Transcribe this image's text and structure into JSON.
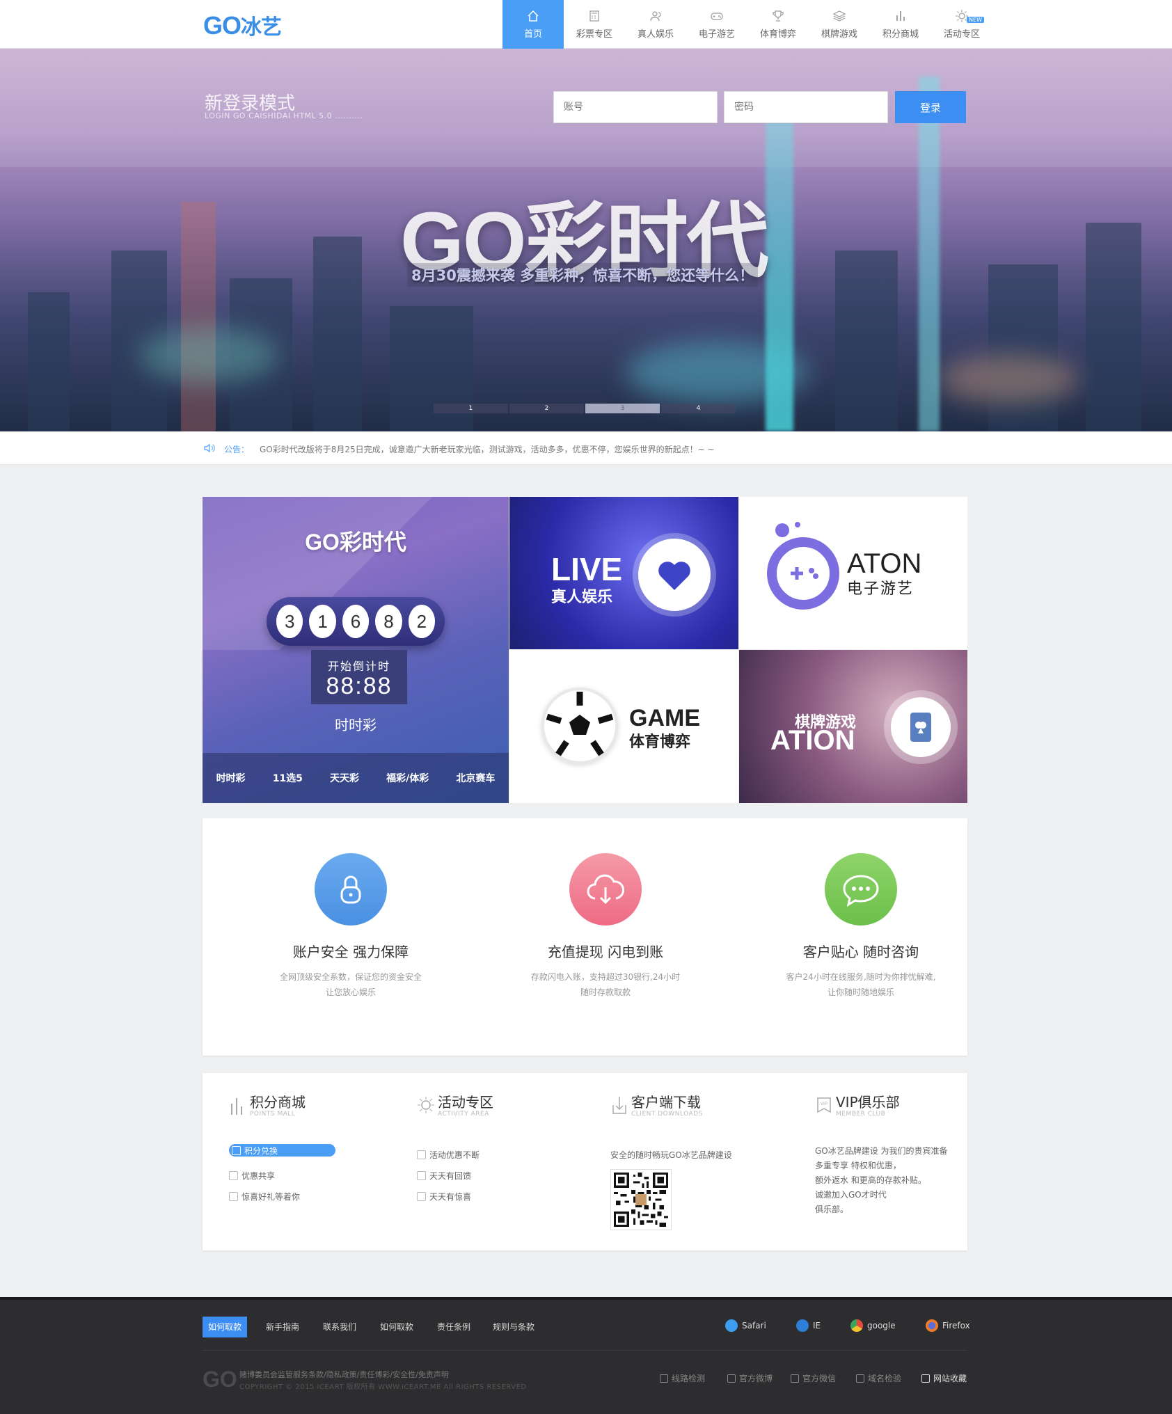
{
  "header": {
    "logo_latin": "GO",
    "logo_cn": "冰艺",
    "nav": [
      {
        "label": "首页",
        "icon": "home-icon",
        "active": true
      },
      {
        "label": "彩票专区",
        "icon": "calculator-icon"
      },
      {
        "label": "真人娱乐",
        "icon": "users-icon"
      },
      {
        "label": "电子游艺",
        "icon": "gamepad-icon"
      },
      {
        "label": "体育博弈",
        "icon": "trophy-icon"
      },
      {
        "label": "棋牌游戏",
        "icon": "layers-icon"
      },
      {
        "label": "积分商城",
        "icon": "bar-chart-icon"
      },
      {
        "label": "活动专区",
        "icon": "sun-icon",
        "badge": "NEW"
      }
    ]
  },
  "hero": {
    "login_title": "新登录模式",
    "login_subtitle": "LOGIN GO CAISHIDAI HTML 5.0 ..........",
    "account_placeholder": "账号",
    "password_placeholder": "密码",
    "login_button": "登录",
    "title": "GO彩时代",
    "subtitle": "8月30震撼来袭 多重彩种，惊喜不断，您还等什么！",
    "slides": [
      "1",
      "2",
      "3",
      "4"
    ],
    "active_slide": 3
  },
  "notice": {
    "label": "公告：",
    "text": "GO彩时代改版将于8月25日完成，诚意邀广大新老玩家光临，测试游戏，活动多多，优惠不停，您娱乐世界的新起点！~ ~"
  },
  "tiles": {
    "lottery": {
      "logo": "GO彩时代",
      "balls": [
        "3",
        "1",
        "6",
        "8",
        "2"
      ],
      "countdown_label": "开始倒计时",
      "countdown_time": "88:88",
      "game_name": "时时彩",
      "games": [
        "时时彩",
        "11选5",
        "天天彩",
        "福彩/体彩",
        "北京赛车"
      ]
    },
    "live": {
      "title": "LIVE",
      "subtitle": "真人娱乐"
    },
    "aton": {
      "title": "ATON",
      "subtitle": "电子游艺"
    },
    "game": {
      "title": "GAME",
      "subtitle": "体育博弈"
    },
    "chess": {
      "title": "棋牌游戏",
      "subtitle": "ATION"
    }
  },
  "features": [
    {
      "title": "账户安全 强力保障",
      "desc1": "全网顶级安全系数，保证您的资金安全",
      "desc2": "让您放心娱乐",
      "color_a": "#4a90e2",
      "color_b": "#6aaaf0",
      "icon": "lock-icon"
    },
    {
      "title": "充值提现 闪电到账",
      "desc1": "存款闪电入账，支持超过30银行,24小时",
      "desc2": "随时存款取款",
      "color_a": "#ee6b84",
      "color_b": "#f59aa8",
      "icon": "cloud-download-icon"
    },
    {
      "title": "客户贴心 随时咨询",
      "desc1": "客户24小时在线服务,随时为你排忧解难,",
      "desc2": "让你随时随地娱乐",
      "color_a": "#6cbf4a",
      "color_b": "#8ed46a",
      "icon": "chat-icon"
    }
  ],
  "services": {
    "points": {
      "title": "积分商城",
      "en": "POINTS MALL",
      "items": [
        "积分兑换",
        "优惠共享",
        "惊喜好礼等着你"
      ]
    },
    "activity": {
      "title": "活动专区",
      "en": "ACTIVITY AREA",
      "items": [
        "活动优惠不断",
        "天天有回馈",
        "天天有惊喜"
      ]
    },
    "client": {
      "title": "客户端下载",
      "en": "CLIENT DOWNLOADS",
      "desc": "安全的随时畅玩GO冰艺品牌建设"
    },
    "vip": {
      "title": "VIP俱乐部",
      "en": "MEMBER CLUB",
      "lines": [
        "GO冰艺品牌建设 为我们的贵宾准备",
        "多重专享 特权和优惠，",
        "额外返水 和更高的存款补贴。",
        "诚邀加入GO才时代",
        "俱乐部。"
      ]
    }
  },
  "footer": {
    "links": [
      "如何取款",
      "新手指南",
      "联系我们",
      "如何取款",
      "责任条例",
      "规则与条款"
    ],
    "browsers": [
      "Safari",
      "IE",
      "google",
      "Firefox"
    ],
    "logo": "GO",
    "copyright1": "赌博委员会监管服务条款/隐私政策/责任博彩/安全性/免责声明",
    "copyright2": "COPYRIGHT © 2015   ICEART 版权所有 WWW.ICEART.ME  All RIGHTS RESERVED",
    "tools": [
      "线路检测",
      "官方微博",
      "官方微信",
      "域名检验",
      "网站收藏"
    ]
  }
}
